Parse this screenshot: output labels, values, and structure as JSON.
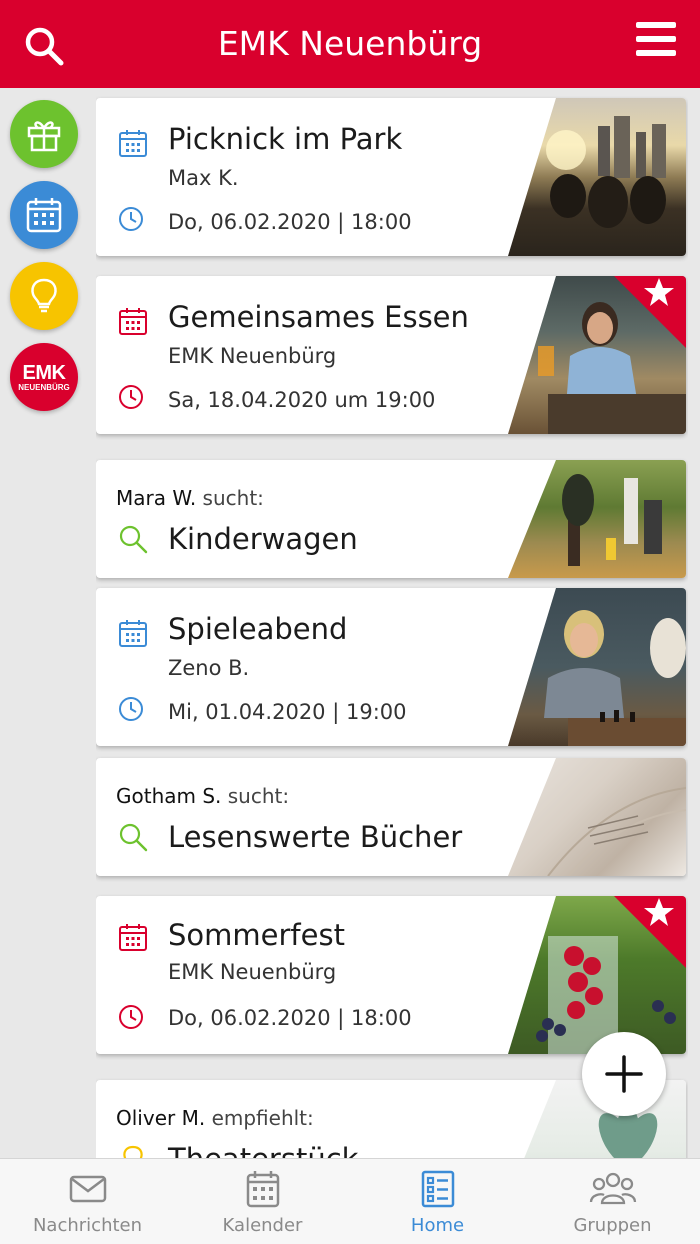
{
  "header": {
    "title": "EMK Neuenbürg",
    "search_icon": "search-icon",
    "menu_icon": "hamburger-menu-icon",
    "color": "#d9002d"
  },
  "quick_rail": {
    "items": [
      {
        "icon": "gift-icon",
        "color": "#6dc22e"
      },
      {
        "icon": "calendar-icon",
        "color": "#3b8bd6"
      },
      {
        "icon": "lightbulb-icon",
        "color": "#f7c400"
      },
      {
        "icon": "emk-logo",
        "color": "#d9002d",
        "logo_line1": "EMK",
        "logo_line2": "NEUENBÜRG"
      }
    ]
  },
  "feed": [
    {
      "type": "event",
      "title": "Picknick im Park",
      "organizer": "Max K.",
      "datetime": "Do, 06.02.2020 | 18:00",
      "accent": "#3b8bd6",
      "featured": false
    },
    {
      "type": "event",
      "title": "Gemeinsames Essen",
      "organizer": "EMK Neuenbürg",
      "datetime": "Sa, 18.04.2020 um 19:00",
      "accent": "#d9002d",
      "featured": true
    },
    {
      "type": "search",
      "person": "Mara W.",
      "verb": "sucht:",
      "title": "Kinderwagen",
      "accent": "#6dc22e"
    },
    {
      "type": "event",
      "title": "Spieleabend",
      "organizer": "Zeno B.",
      "datetime": "Mi, 01.04.2020 | 19:00",
      "accent": "#3b8bd6",
      "featured": false
    },
    {
      "type": "search",
      "person": "Gotham S.",
      "verb": "sucht:",
      "title": "Lesenswerte Bücher",
      "accent": "#6dc22e"
    },
    {
      "type": "event",
      "title": "Sommerfest",
      "organizer": "EMK Neuenbürg",
      "datetime": "Do, 06.02.2020 | 18:00",
      "accent": "#d9002d",
      "featured": true
    },
    {
      "type": "tip",
      "person": "Oliver M.",
      "verb": "empfiehlt:",
      "title": "Theaterstück",
      "accent": "#f7c400"
    }
  ],
  "fab": {
    "icon": "plus-icon"
  },
  "tabbar": {
    "tabs": [
      {
        "label": "Nachrichten",
        "icon": "envelope-icon",
        "active": false
      },
      {
        "label": "Kalender",
        "icon": "calendar-icon",
        "active": false
      },
      {
        "label": "Home",
        "icon": "list-icon",
        "active": true
      },
      {
        "label": "Gruppen",
        "icon": "group-icon",
        "active": false
      }
    ],
    "active_color": "#3b8bd6"
  }
}
